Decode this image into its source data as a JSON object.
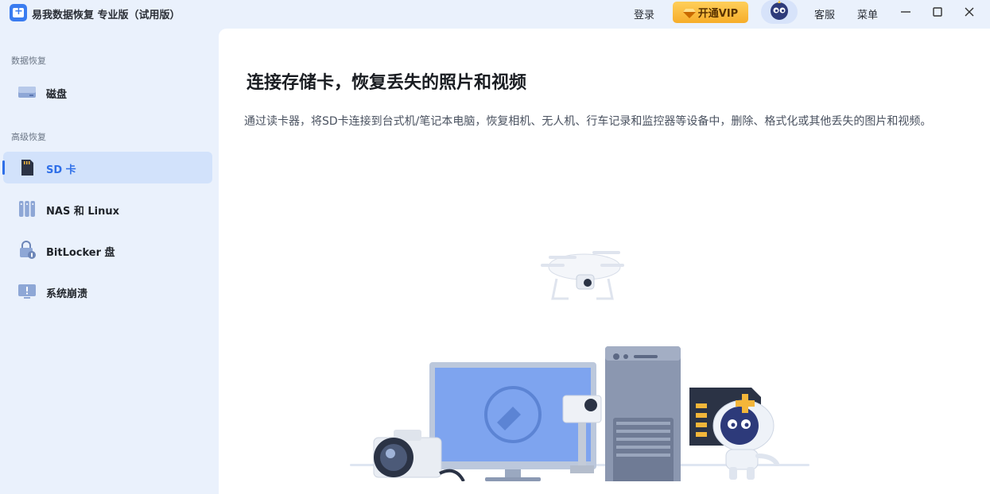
{
  "app": {
    "title": "易我数据恢复 专业版（试用版）"
  },
  "titlebar": {
    "login": "登录",
    "vip": "开通VIP",
    "support": "客服",
    "menu": "菜单"
  },
  "sidebar": {
    "section_data_recovery": "数据恢复",
    "section_advanced": "高级恢复",
    "items": [
      {
        "label": "磁盘"
      },
      {
        "label": "SD 卡"
      },
      {
        "label": "NAS 和 Linux"
      },
      {
        "label": "BitLocker 盘"
      },
      {
        "label": "系统崩溃"
      }
    ]
  },
  "main": {
    "title": "连接存储卡，恢复丢失的照片和视频",
    "description": "通过读卡器，将SD卡连接到台式机/笔记本电脑，恢复相机、无人机、行车记录和监控器等设备中，删除、格式化或其他丢失的图片和视频。"
  },
  "colors": {
    "accent": "#2f6fe8",
    "sidebar_bg": "#eaf1fc",
    "active_item_bg": "#d2e2fb",
    "vip_gold": "#f6ad2a"
  }
}
